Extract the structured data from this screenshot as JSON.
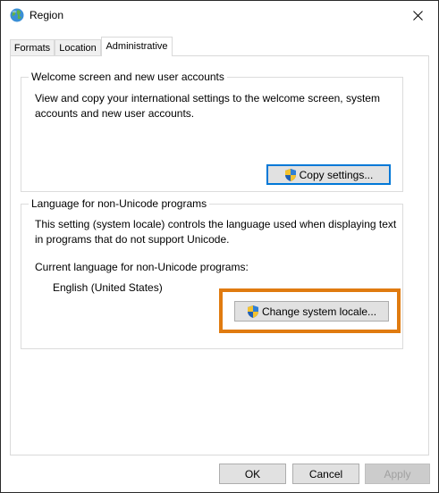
{
  "window": {
    "title": "Region"
  },
  "tabs": [
    {
      "label": "Formats"
    },
    {
      "label": "Location"
    },
    {
      "label": "Administrative"
    }
  ],
  "welcome_group": {
    "title": "Welcome screen and new user accounts",
    "description": "View and copy your international settings to the welcome screen, system accounts and new user accounts.",
    "button_label": "Copy settings..."
  },
  "nonunicode_group": {
    "title": "Language for non-Unicode programs",
    "description": "This setting (system locale) controls the language used when displaying text in programs that do not support Unicode.",
    "current_label": "Current language for non-Unicode programs:",
    "current_value": "English (United States)",
    "button_label": "Change system locale..."
  },
  "footer": {
    "ok_label": "OK",
    "cancel_label": "Cancel",
    "apply_label": "Apply"
  },
  "colors": {
    "highlight": "#e07b10",
    "default_button_border": "#0078d7"
  },
  "icons": {
    "window_icon": "globe-icon",
    "button_icon": "uac-shield-icon",
    "close_icon": "close-icon"
  }
}
